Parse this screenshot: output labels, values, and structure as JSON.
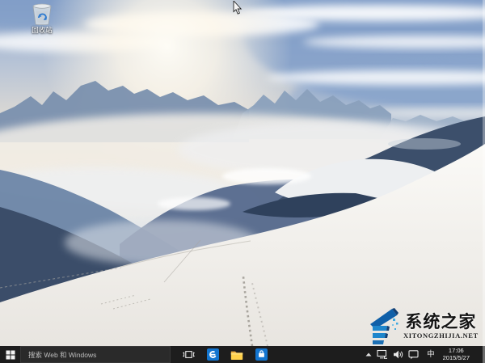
{
  "desktop": {
    "icons": [
      {
        "name": "recycle-bin",
        "label": "回收站",
        "icon": "recycle-bin-icon"
      }
    ],
    "cursor": "arrow-pointer",
    "wallpaper": "snowy-alpine-mountains-winter-haze"
  },
  "taskbar": {
    "background_color": "#1d1d1d",
    "start": {
      "name": "start-button",
      "icon": "windows-logo-icon"
    },
    "search": {
      "placeholder": "搜索 Web 和 Windows"
    },
    "buttons": [
      {
        "name": "task-view",
        "icon": "task-view-icon"
      },
      {
        "name": "edge-browser",
        "icon": "edge-icon",
        "tile_color": "#1375cf"
      },
      {
        "name": "file-explorer",
        "icon": "folder-icon",
        "folder_color": "#f9c440"
      },
      {
        "name": "windows-store",
        "icon": "store-bag-icon",
        "tile_color": "#1375cf"
      }
    ],
    "tray": {
      "chevron": {
        "name": "tray-overflow",
        "icon": "chevron-up-icon"
      },
      "icons": [
        {
          "name": "network",
          "icon": "network-icon"
        },
        {
          "name": "volume",
          "icon": "speaker-icon"
        },
        {
          "name": "action-center",
          "icon": "message-bubble-icon"
        }
      ],
      "ime_indicator": "中",
      "clock": {
        "time": "17:06",
        "date": "2015/5/27"
      }
    }
  },
  "watermark": {
    "logo": "xitongzhijia-house-logo",
    "title": "系统之家",
    "subtitle": "XITONGZHIJIA.NET",
    "logo_blue": "#1e86cc"
  },
  "colors": {
    "sky_top_blue": "#8ba4c9",
    "horizon_cream": "#e9ddca",
    "far_ridge_haze": "#7a90ae",
    "dark_ridge": "#3b4d69",
    "snow_white": "#fbfaf7",
    "accent_tile_blue": "#1375cf"
  }
}
